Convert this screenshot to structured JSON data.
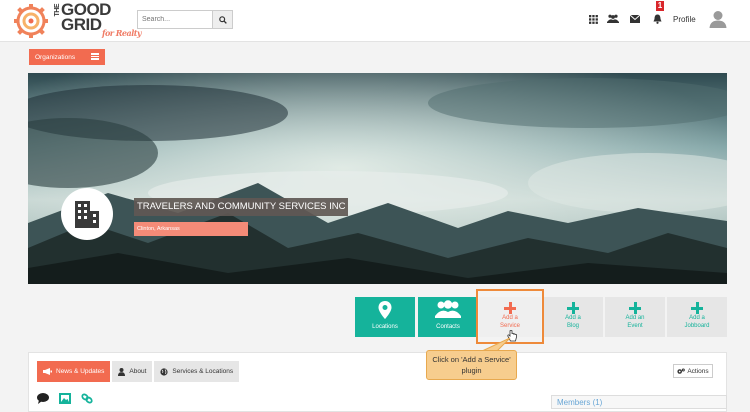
{
  "header": {
    "logo": {
      "word_the": "THE",
      "word_good": "GOOD",
      "word_grid": "GRID",
      "tagline": "for Realty"
    },
    "search": {
      "placeholder": "Search..."
    },
    "icons": [
      "apps-grid-icon",
      "people-icon",
      "envelope-icon",
      "bell-icon"
    ],
    "notification_count": "1",
    "profile_label": "Profile"
  },
  "organizations_button": {
    "label": "Organizations"
  },
  "organization": {
    "name": "TRAVELERS AND COMMUNITY SERVICES INC",
    "location": "Clinton, Arkansas"
  },
  "plugins": [
    {
      "label": "Locations"
    },
    {
      "label": "Contacts"
    },
    {
      "label": "Add a Service"
    },
    {
      "label": "Add a Blog"
    },
    {
      "label": "Add an Event"
    },
    {
      "label": "Add a Jobboard"
    }
  ],
  "callout": {
    "text": "Click on 'Add a Service' plugin"
  },
  "tabs": [
    {
      "label": "News & Updates"
    },
    {
      "label": "About"
    },
    {
      "label": "Services & Locations"
    }
  ],
  "actions_label": "Actions",
  "members_label": "Members (1)",
  "colors": {
    "accent": "#f26b50",
    "teal": "#15b39b",
    "highlight": "#ee8a3a",
    "callout": "#f7cd8e"
  }
}
